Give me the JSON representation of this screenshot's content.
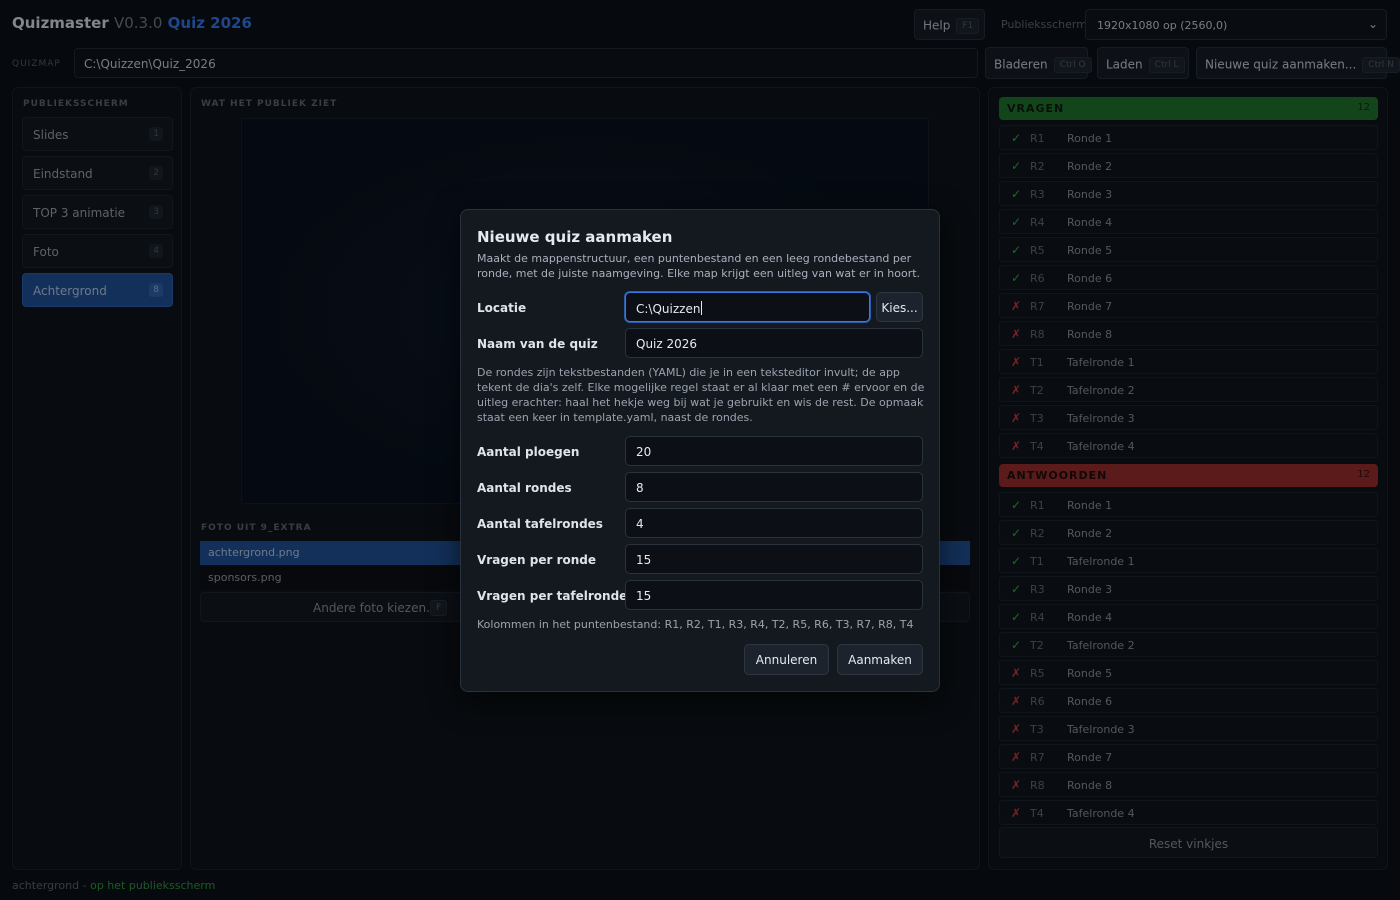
{
  "app": {
    "name": "Quizmaster",
    "version": "V0.3.0",
    "quiz": "Quiz 2026"
  },
  "topbar": {
    "help_label": "Help",
    "help_key": "F1",
    "screen_label": "Publieksscherm",
    "screen_value": "1920x1080 op (2560,0)"
  },
  "quizmap": {
    "label": "QUIZMAP",
    "path": "C:\\Quizzen\\Quiz_2026",
    "browse_label": "Bladeren",
    "browse_key": "Ctrl O",
    "load_label": "Laden",
    "load_key": "Ctrl L",
    "new_label": "Nieuwe quiz aanmaken...",
    "new_key": "Ctrl N"
  },
  "sidebar": {
    "title": "PUBLIEKSSCHERM",
    "items": [
      {
        "label": "Slides",
        "key": "1"
      },
      {
        "label": "Eindstand",
        "key": "2"
      },
      {
        "label": "TOP 3 animatie",
        "key": "3"
      },
      {
        "label": "Foto",
        "key": "4"
      },
      {
        "label": "Achtergrond",
        "key": "8"
      }
    ]
  },
  "center": {
    "title": "WAT HET PUBLIEK ZIET",
    "photo_title": "FOTO UIT 9_EXTRA",
    "files": [
      "achtergrond.png",
      "sponsors.png"
    ],
    "other_photo_label": "Andere foto kiezen...",
    "other_photo_key": "F"
  },
  "questions": {
    "title": "VRAGEN",
    "count": "12",
    "rows": [
      {
        "mark": "✓",
        "code": "R1",
        "name": "Ronde 1"
      },
      {
        "mark": "✓",
        "code": "R2",
        "name": "Ronde 2"
      },
      {
        "mark": "✓",
        "code": "R3",
        "name": "Ronde 3"
      },
      {
        "mark": "✓",
        "code": "R4",
        "name": "Ronde 4"
      },
      {
        "mark": "✓",
        "code": "R5",
        "name": "Ronde 5"
      },
      {
        "mark": "✓",
        "code": "R6",
        "name": "Ronde 6"
      },
      {
        "mark": "✗",
        "code": "R7",
        "name": "Ronde 7"
      },
      {
        "mark": "✗",
        "code": "R8",
        "name": "Ronde 8"
      },
      {
        "mark": "✗",
        "code": "T1",
        "name": "Tafelronde 1"
      },
      {
        "mark": "✗",
        "code": "T2",
        "name": "Tafelronde 2"
      },
      {
        "mark": "✗",
        "code": "T3",
        "name": "Tafelronde 3"
      },
      {
        "mark": "✗",
        "code": "T4",
        "name": "Tafelronde 4"
      }
    ]
  },
  "answers": {
    "title": "ANTWOORDEN",
    "count": "12",
    "rows": [
      {
        "mark": "✓",
        "code": "R1",
        "name": "Ronde 1"
      },
      {
        "mark": "✓",
        "code": "R2",
        "name": "Ronde 2"
      },
      {
        "mark": "✓",
        "code": "T1",
        "name": "Tafelronde 1"
      },
      {
        "mark": "✓",
        "code": "R3",
        "name": "Ronde 3"
      },
      {
        "mark": "✓",
        "code": "R4",
        "name": "Ronde 4"
      },
      {
        "mark": "✓",
        "code": "T2",
        "name": "Tafelronde 2"
      },
      {
        "mark": "✗",
        "code": "R5",
        "name": "Ronde 5"
      },
      {
        "mark": "✗",
        "code": "R6",
        "name": "Ronde 6"
      },
      {
        "mark": "✗",
        "code": "T3",
        "name": "Tafelronde 3"
      },
      {
        "mark": "✗",
        "code": "R7",
        "name": "Ronde 7"
      },
      {
        "mark": "✗",
        "code": "R8",
        "name": "Ronde 8"
      },
      {
        "mark": "✗",
        "code": "T4",
        "name": "Tafelronde 4"
      }
    ],
    "reset_label": "Reset vinkjes"
  },
  "footer": {
    "item": "achtergrond",
    "sep": " - ",
    "status": "op het publieksscherm"
  },
  "modal": {
    "title": "Nieuwe quiz aanmaken",
    "description": "Maakt de mappenstructuur, een puntenbestand en een leeg rondebestand per ronde, met de juiste naamgeving. Elke map krijgt een uitleg van wat er in hoort.",
    "location_label": "Locatie",
    "location_value": "C:\\Quizzen",
    "choose_label": "Kies...",
    "name_label": "Naam van de quiz",
    "name_value": "Quiz 2026",
    "yaml_note": "De rondes zijn tekstbestanden (YAML) die je in een teksteditor invult; de app tekent de dia's zelf. Elke mogelijke regel staat er al klaar met een # ervoor en de uitleg erachter: haal het hekje weg bij wat je gebruikt en wis de rest. De opmaak staat een keer in template.yaml, naast de rondes.",
    "fields": [
      {
        "label": "Aantal ploegen",
        "value": "20"
      },
      {
        "label": "Aantal rondes",
        "value": "8"
      },
      {
        "label": "Aantal tafelrondes",
        "value": "4"
      },
      {
        "label": "Vragen per ronde",
        "value": "15"
      },
      {
        "label": "Vragen per tafelronde",
        "value": "15"
      }
    ],
    "columns_note": "Kolommen in het puntenbestand: R1, R2, T1, R3, R4, T2, R5, R6, T3, R7, R8, T4",
    "cancel_label": "Annuleren",
    "create_label": "Aanmaken"
  }
}
